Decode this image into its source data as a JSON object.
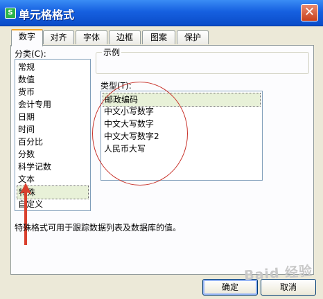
{
  "window": {
    "icon_text": "S",
    "title": "单元格格式",
    "close_glyph": "✕"
  },
  "tabs": [
    {
      "label": "数字"
    },
    {
      "label": "对齐"
    },
    {
      "label": "字体"
    },
    {
      "label": "边框"
    },
    {
      "label": "图案"
    },
    {
      "label": "保护"
    }
  ],
  "category": {
    "label": "分类(C):",
    "items": [
      "常规",
      "数值",
      "货币",
      "会计专用",
      "日期",
      "时间",
      "百分比",
      "分数",
      "科学记数",
      "文本",
      "特殊",
      "自定义"
    ],
    "selected": "特殊"
  },
  "sample": {
    "label": "示例"
  },
  "type": {
    "label": "类型(T):",
    "items": [
      "邮政编码",
      "中文小写数字",
      "中文大写数字",
      "中文大写数字2",
      "人民币大写"
    ],
    "selected": "邮政编码"
  },
  "description": "特殊格式可用于跟踪数据列表及数据库的值。",
  "buttons": {
    "ok": "确定",
    "cancel": "取消"
  },
  "watermark": "Baid 经验"
}
